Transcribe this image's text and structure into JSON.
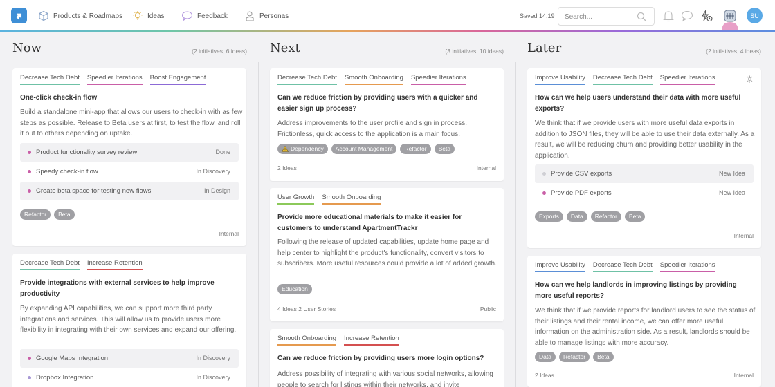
{
  "nav": {
    "items": [
      {
        "label": "Products & Roadmaps",
        "icon": "cube-icon"
      },
      {
        "label": "Ideas",
        "icon": "lightbulb-icon"
      },
      {
        "label": "Feedback",
        "icon": "speech-bubble-icon"
      },
      {
        "label": "Personas",
        "icon": "persona-icon"
      }
    ],
    "saved": "Saved 14:19",
    "search_placeholder": "Search...",
    "avatar_initials": "SU"
  },
  "tag_colors": {
    "Decrease Tech Debt": "#6fc1a6",
    "Speedier Iterations": "#c95fa7",
    "Boost Engagement": "#8c6ad6",
    "Increase Retention": "#d45050",
    "Smooth Onboarding": "#e59a4f",
    "User Growth": "#8cc95a",
    "Improve Usability": "#5b8fd6"
  },
  "columns": [
    {
      "title": "Now",
      "count": "(2 initiatives, 6 ideas)",
      "cards": [
        {
          "tags": [
            "Decrease Tech Debt",
            "Speedier Iterations",
            "Boost Engagement"
          ],
          "title": "One-click check-in flow",
          "description": "Build a standalone mini-app that allows our users to check-in with as few steps as possible. Release to Beta users at first, to test the flow, and roll it out to others depending on uptake.",
          "ideas": [
            {
              "label": "Product functionality survey review",
              "status": "Done",
              "dot": "#c95fa7"
            },
            {
              "label": "Speedy check-in flow",
              "status": "In Discovery",
              "dot": "#c95fa7"
            },
            {
              "label": "Create beta space for testing new flows",
              "status": "In Design",
              "dot": "#c95fa7"
            }
          ],
          "pills": [
            "Refactor",
            "Beta"
          ],
          "meta_left": "",
          "visibility": "Internal"
        },
        {
          "tags": [
            "Decrease Tech Debt",
            "Increase Retention"
          ],
          "title": "Provide integrations with external services to help improve productivity",
          "description": "By expanding API capabilities, we can support more third party integrations and services. This will allow us to provide users more flexibility in integrating with their own services and expand our offering.",
          "ideas": [
            {
              "label": "Google Maps Integration",
              "status": "In Discovery",
              "dot": "#c95fa7"
            },
            {
              "label": "Dropbox Integration",
              "status": "In Discovery",
              "dot": "#a99ad6"
            }
          ],
          "pills": [],
          "meta_left": "",
          "visibility": ""
        }
      ]
    },
    {
      "title": "Next",
      "count": "(3 initiatives, 10 ideas)",
      "cards": [
        {
          "tags": [
            "Decrease Tech Debt",
            "Smooth Onboarding",
            "Speedier Iterations"
          ],
          "title": "Can we reduce friction by providing users with a quicker and easier sign up process?",
          "description": "Address improvements to the user profile and sign in process. Frictionless, quick access to the application is a main focus.",
          "ideas": [],
          "pills": [
            "Dependency",
            "Account Management",
            "Refactor",
            "Beta"
          ],
          "meta_left": "2 Ideas",
          "visibility": "Internal"
        },
        {
          "tags": [
            "User Growth",
            "Smooth Onboarding"
          ],
          "title": "Provide more educational materials to make it easier for customers to understand ApartmentTrackr",
          "description": "Following the release of updated capabilities, update home page and help center to highlight the product's functionality, convert visitors to subscribers. More useful resources could provide a lot of added growth.",
          "ideas": [],
          "pills": [
            "Education"
          ],
          "meta_left": "4 Ideas  2 User Stories",
          "visibility": "Public"
        },
        {
          "tags": [
            "Smooth Onboarding",
            "Increase Retention"
          ],
          "title": "Can we reduce friction by providing users more login options?",
          "description": "Address possibility of integrating with various social networks, allowing people to search for listings within their networks, and invite",
          "ideas": [],
          "pills": [],
          "meta_left": "",
          "visibility": ""
        }
      ]
    },
    {
      "title": "Later",
      "count": "(2 initiatives, 4 ideas)",
      "cards": [
        {
          "tags": [
            "Improve Usability",
            "Decrease Tech Debt",
            "Speedier Iterations"
          ],
          "title": "How can we help users understand their data with more useful exports?",
          "description": "We think that if we provide users with more useful data exports in addition to JSON files, they will be able to use their data externally. As a result, we will be reducing churn and providing better usability in the application.",
          "ideas": [
            {
              "label": "Provide CSV exports",
              "status": "New Idea",
              "dot": "#cfcfd4"
            },
            {
              "label": "Provide PDF exports",
              "status": "New Idea",
              "dot": "#c95fa7"
            }
          ],
          "pills": [
            "Exports",
            "Data",
            "Refactor",
            "Beta"
          ],
          "meta_left": "",
          "visibility": "Internal"
        },
        {
          "tags": [
            "Improve Usability",
            "Decrease Tech Debt",
            "Speedier Iterations"
          ],
          "title": "How can we help landlords in improving listings by providing more useful reports?",
          "description": "We think that if we provide reports for landlord users to see the status of their listings and their rental income, we can offer more useful information on the administration side. As a result, landlords should be able to manage listings with more accuracy.",
          "ideas": [],
          "pills": [
            "Data",
            "Refactor",
            "Beta"
          ],
          "meta_left": "2 Ideas",
          "visibility": "Internal"
        }
      ]
    }
  ]
}
